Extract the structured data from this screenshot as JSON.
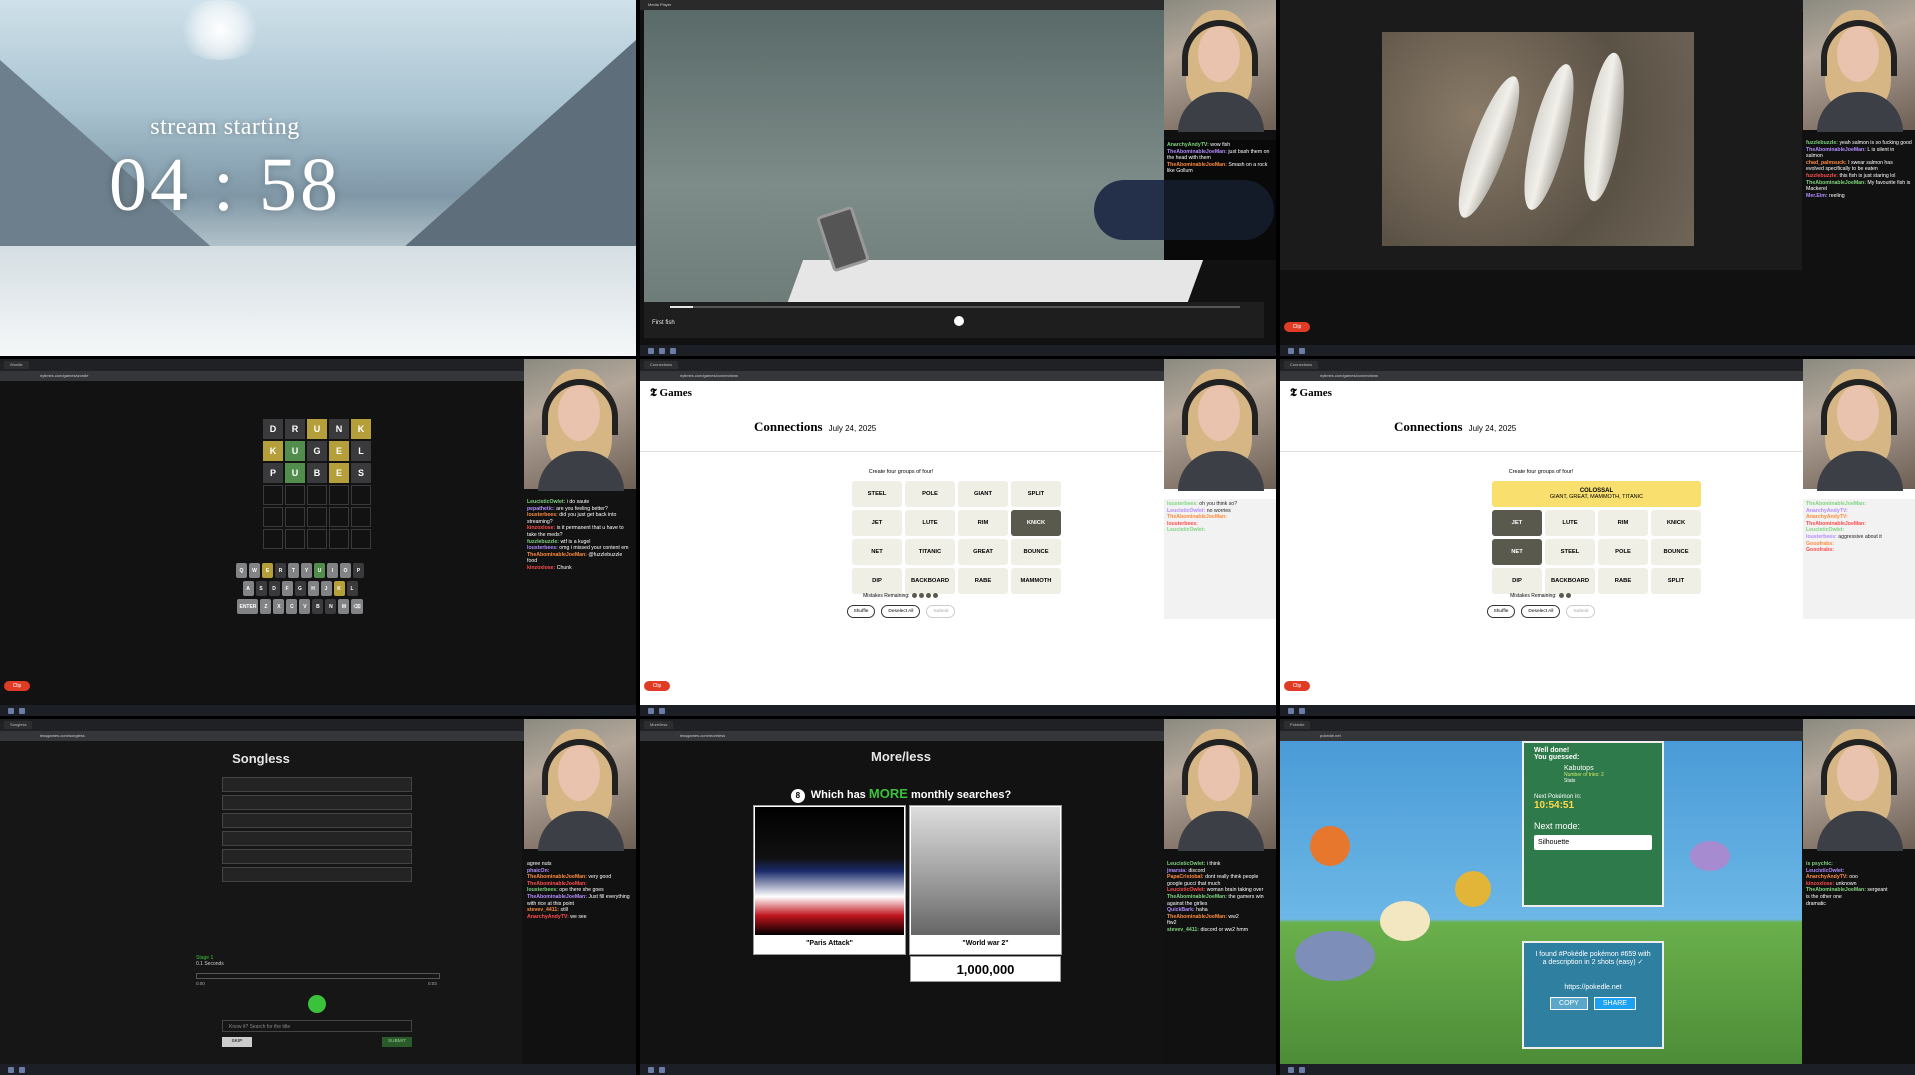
{
  "stream": {
    "caption": "stream starting",
    "timer": "04 : 58",
    "clip_label": "Clip"
  },
  "video_player": {
    "title": "First fish",
    "window_title": "Media Player",
    "progress": 0.04
  },
  "fish_viewer": {
    "filename": "20250723_123456.jpg",
    "chat": [
      {
        "user": "fuzzlebuzzle",
        "text": "yeah salmon is so fucking good"
      },
      {
        "user": "TheAbominableJoeMan",
        "text": "L is silent in salmon"
      },
      {
        "user": "chad_palmsuck",
        "text": "I swear salmon has evolved specifically to be eaten"
      },
      {
        "user": "fuzzlebuzzle",
        "text": "this fish is just staring lol"
      },
      {
        "user": "TheAbominableJoeMan",
        "text": "My favourite fish is Mackerel"
      },
      {
        "user": "Mer.Eim",
        "text": "reeling"
      }
    ]
  },
  "video_chat": [
    {
      "user": "AnarchyAndyTV",
      "text": "wow fish"
    },
    {
      "user": "TheAbominableJoeMan",
      "text": "just bash them on the head with them"
    },
    {
      "user": "TheAbominableJoeMan",
      "text": "Smash on a rock like Gollum"
    }
  ],
  "wordle": {
    "rows": [
      [
        {
          "l": "D",
          "s": "x"
        },
        {
          "l": "R",
          "s": "x"
        },
        {
          "l": "U",
          "s": "y"
        },
        {
          "l": "N",
          "s": "x"
        },
        {
          "l": "K",
          "s": "y"
        }
      ],
      [
        {
          "l": "K",
          "s": "y"
        },
        {
          "l": "U",
          "s": "g"
        },
        {
          "l": "G",
          "s": "x"
        },
        {
          "l": "E",
          "s": "y"
        },
        {
          "l": "L",
          "s": "x"
        }
      ],
      [
        {
          "l": "P",
          "s": "x"
        },
        {
          "l": "U",
          "s": "g"
        },
        {
          "l": "B",
          "s": "x"
        },
        {
          "l": "E",
          "s": "y"
        },
        {
          "l": "S",
          "s": "x"
        }
      ]
    ],
    "keyboard": [
      [
        {
          "k": "Q"
        },
        {
          "k": "W"
        },
        {
          "k": "E",
          "s": "y"
        },
        {
          "k": "R",
          "s": "x"
        },
        {
          "k": "T"
        },
        {
          "k": "Y"
        },
        {
          "k": "U",
          "s": "g"
        },
        {
          "k": "I"
        },
        {
          "k": "O"
        },
        {
          "k": "P",
          "s": "x"
        }
      ],
      [
        {
          "k": "A"
        },
        {
          "k": "S",
          "s": "x"
        },
        {
          "k": "D",
          "s": "x"
        },
        {
          "k": "F"
        },
        {
          "k": "G",
          "s": "x"
        },
        {
          "k": "H"
        },
        {
          "k": "J"
        },
        {
          "k": "K",
          "s": "y"
        },
        {
          "k": "L",
          "s": "x"
        }
      ],
      [
        {
          "k": "ENTER"
        },
        {
          "k": "Z"
        },
        {
          "k": "X"
        },
        {
          "k": "C"
        },
        {
          "k": "V"
        },
        {
          "k": "B",
          "s": "x"
        },
        {
          "k": "N",
          "s": "x"
        },
        {
          "k": "M"
        },
        {
          "k": "⌫"
        }
      ]
    ],
    "chat": [
      {
        "user": "LeucisticOwlet",
        "text": "i do saute"
      },
      {
        "user": "pepathetic",
        "text": "are you feeling better?"
      },
      {
        "user": "lousterbees",
        "text": "did you just get back into streaming?"
      },
      {
        "user": "kinzoxlose",
        "text": "is it permanent that u have to take the meds?"
      },
      {
        "user": "fuzzlebuzzle",
        "text": "wtf is a kugel"
      },
      {
        "user": "lousterbees",
        "text": "omg i missed your content em"
      },
      {
        "user": "TheAbominableJoeMan",
        "text": "@fuzzlebuzzle food"
      },
      {
        "user": "kinzoxlose",
        "text": "Chunk"
      }
    ]
  },
  "connections": {
    "brand": "Games",
    "title": "Connections",
    "date": "July 24, 2025",
    "prompt": "Create four groups of four!",
    "left_board": [
      "STEEL",
      "POLE",
      "GIANT",
      "SPLIT",
      "JET",
      "LUTE",
      "RIM",
      "KNICK",
      "NET",
      "TITANIC",
      "GREAT",
      "BOUNCE",
      "DIP",
      "BACKBOARD",
      "RABE",
      "MAMMOTH"
    ],
    "left_selected": [
      "KNICK"
    ],
    "mistakes_label": "Mistakes Remaining:",
    "left_mistakes": 4,
    "right_solved": {
      "name": "COLOSSAL",
      "members": "GIANT, GREAT, MAMMOTH, TITANIC"
    },
    "right_board": [
      "JET",
      "LUTE",
      "RIM",
      "KNICK",
      "NET",
      "STEEL",
      "POLE",
      "BOUNCE",
      "DIP",
      "BACKBOARD",
      "RABE",
      "SPLIT"
    ],
    "right_selected": [
      "JET",
      "NET"
    ],
    "right_mistakes": 2,
    "buttons": {
      "shuffle": "Shuffle",
      "deselect": "Deselect All",
      "submit": "Submit"
    }
  },
  "songless": {
    "title": "Songless",
    "stage": "Stage 1",
    "stage_sub": "0.1 Seconds",
    "time_start": "0:00",
    "time_end": "0:03",
    "search_placeholder": "Know it? Search for the title",
    "skip": "SKIP",
    "submit": "SUBMIT",
    "chat": [
      {
        "user": "",
        "text": "agree nuts"
      },
      {
        "user": "phaicOn",
        "text": ""
      },
      {
        "user": "TheAbominableJoeMan",
        "text": "very good"
      },
      {
        "user": "TheAbominableJoeMan",
        "text": ""
      },
      {
        "user": "lousterbees",
        "text": "ope there she goes"
      },
      {
        "user": "TheAbominableJoeMan",
        "text": "Just fill everything with rice at this point"
      },
      {
        "user": "stevev_4411",
        "text": "still"
      },
      {
        "user": "AnarchyAndyTV",
        "text": "we see"
      }
    ]
  },
  "moreless": {
    "title": "More/less",
    "question_num": "8",
    "question_pre": "Which has",
    "question_more": "MORE",
    "question_post": "monthly searches?",
    "left_label": "\"Paris Attack\"",
    "right_label": "\"World war 2\"",
    "right_value": "1,000,000",
    "chat": [
      {
        "user": "LeucisticOwlet",
        "text": "i think"
      },
      {
        "user": "jmarsia",
        "text": "discord"
      },
      {
        "user": "PapaCristobal",
        "text": "dont really think people google gucci that much"
      },
      {
        "user": "LeucisticOwlet",
        "text": "woman brain taking over"
      },
      {
        "user": "TheAbominableJoeMan",
        "text": "the gamers win against the girlies"
      },
      {
        "user": "QuickBark",
        "text": "haha"
      },
      {
        "user": "TheAbominableJoeMan",
        "text": "ww2"
      },
      {
        "user": "",
        "text": "ftw2"
      },
      {
        "user": "stevev_4411",
        "text": "discord or ww2 hmm"
      }
    ]
  },
  "pokedle": {
    "well_done": "Well done!",
    "you_guessed": "You guessed:",
    "pokemon": "Kabutops",
    "tries": "Number of tries: 2",
    "stats": "Stats",
    "next_label": "Next Pokémon in:",
    "next_time": "10:54:51",
    "next_mode_label": "Next mode:",
    "next_mode": "Silhouette",
    "share_text": "I found #Pokédle pokémon #659 with a description in 2 shots (easy) ✓",
    "share_url": "https://pokedle.net",
    "copy": "COPY",
    "share": "SHARE",
    "chat": [
      {
        "user": "is psychic",
        "text": ""
      },
      {
        "user": "LeucisticOwlet",
        "text": ""
      },
      {
        "user": "AnarchyAndyTV",
        "text": "ooo"
      },
      {
        "user": "kinzoxlose",
        "text": "unknown"
      },
      {
        "user": "TheAbominableJoeMan",
        "text": "sergeant"
      },
      {
        "user": "",
        "text": "is the other one"
      },
      {
        "user": "",
        "text": "dramatic"
      }
    ]
  },
  "connections_right_chat": [
    {
      "user": "TheAbominableJoeMan",
      "text": ""
    },
    {
      "user": "AnarchyAndyTV",
      "text": ""
    },
    {
      "user": "AnarchyAndyTV",
      "text": ""
    },
    {
      "user": "TheAbominableJoeMan",
      "text": ""
    },
    {
      "user": "LeucisticOwlet",
      "text": ""
    },
    {
      "user": "lousterbees",
      "text": "aggressive about it"
    },
    {
      "user": "Gooofrabs",
      "text": ""
    },
    {
      "user": "Gooofrabs",
      "text": ""
    }
  ],
  "connections_left_chat": [
    {
      "user": "lousterbees",
      "text": "oh you think so?"
    },
    {
      "user": "LeucisticOwlet",
      "text": "no worries"
    },
    {
      "user": "TheAbominableJoeMan",
      "text": ""
    },
    {
      "user": "lousterbees",
      "text": ""
    },
    {
      "user": "LeucisticOwlet",
      "text": ""
    }
  ]
}
